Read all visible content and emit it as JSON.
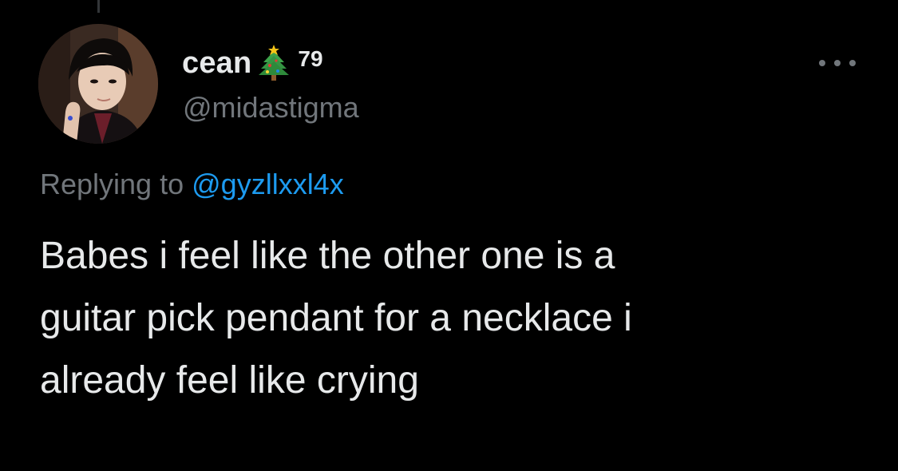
{
  "author": {
    "display_name": "cean",
    "emoji": "christmas-tree-emoji",
    "name_suffix": "79",
    "handle": "@midastigma"
  },
  "reply": {
    "prefix": "Replying to",
    "mention": "@gyzllxxl4x"
  },
  "tweet": {
    "lines": [
      "Babes i feel like the other one is a",
      "guitar pick pendant for a necklace i",
      "already feel like crying"
    ]
  },
  "icons": {
    "more": "more-horizontal-icon"
  },
  "colors": {
    "background": "#000000",
    "text": "#e7e9ea",
    "secondary": "#71767b",
    "link": "#1d9bf0"
  }
}
